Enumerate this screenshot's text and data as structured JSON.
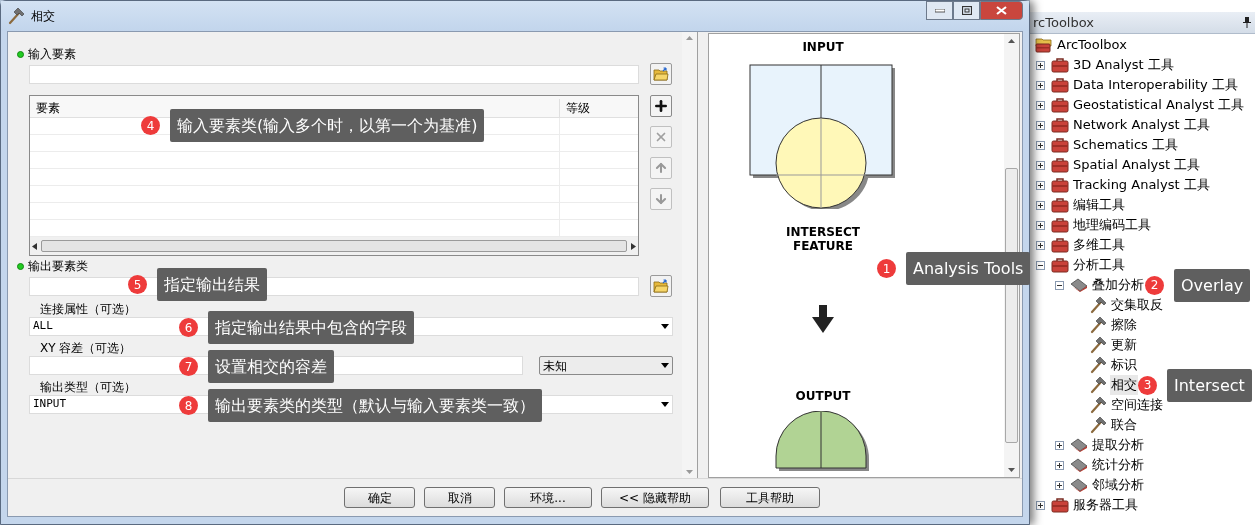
{
  "dialog": {
    "title": "相交",
    "params": [
      {
        "kind": "path",
        "label": "输入要素",
        "required": true
      },
      {
        "kind": "list",
        "columns": [
          "要素",
          "等级"
        ],
        "callout": {
          "number": "4",
          "text": "输入要素类(输入多个时，以第一个为基准)"
        }
      },
      {
        "kind": "path",
        "label": "输出要素类",
        "required": true,
        "callout": {
          "number": "5",
          "text": "指定输出结果"
        }
      },
      {
        "kind": "combo",
        "label": "连接属性（可选）",
        "value": "ALL",
        "callout": {
          "number": "6",
          "text": "指定输出结果中包含的字段"
        }
      },
      {
        "kind": "xy",
        "label": "XY 容差（可选）",
        "unit": "未知",
        "callout": {
          "number": "7",
          "text": "设置相交的容差"
        }
      },
      {
        "kind": "combo",
        "label": "输出类型（可选）",
        "value": "INPUT",
        "callout": {
          "number": "8",
          "text": "输出要素类的类型（默认与输入要素类一致）"
        }
      }
    ],
    "buttons": [
      "确定",
      "取消",
      "环境...",
      "<< 隐藏帮助"
    ],
    "help": {
      "input_label": "INPUT",
      "intersect_label": "INTERSECT FEATURE",
      "output_label": "OUTPUT",
      "button": "工具帮助",
      "callout": {
        "number": "1",
        "text": "Analysis Tools"
      }
    }
  },
  "toolbox": {
    "title": "rcToolbox",
    "tree": [
      {
        "label": "ArcToolbox",
        "kind": "root",
        "children": [
          {
            "label": "3D Analyst 工具",
            "kind": "toolbox",
            "expanded": false
          },
          {
            "label": "Data Interoperability 工具",
            "kind": "toolbox",
            "expanded": false
          },
          {
            "label": "Geostatistical Analyst 工具",
            "kind": "toolbox",
            "expanded": false
          },
          {
            "label": "Network Analyst 工具",
            "kind": "toolbox",
            "expanded": false
          },
          {
            "label": "Schematics 工具",
            "kind": "toolbox",
            "expanded": false
          },
          {
            "label": "Spatial Analyst 工具",
            "kind": "toolbox",
            "expanded": false
          },
          {
            "label": "Tracking Analyst 工具",
            "kind": "toolbox",
            "expanded": false
          },
          {
            "label": "编辑工具",
            "kind": "toolbox",
            "expanded": false
          },
          {
            "label": "地理编码工具",
            "kind": "toolbox",
            "expanded": false
          },
          {
            "label": "多维工具",
            "kind": "toolbox",
            "expanded": false
          },
          {
            "label": "分析工具",
            "kind": "toolbox",
            "expanded": true,
            "children": [
              {
                "label": "叠加分析",
                "kind": "toolset",
                "expanded": true,
                "callout": {
                  "number": "2",
                  "text": "Overlay"
                },
                "children": [
                  {
                    "label": "交集取反",
                    "kind": "tool",
                    "selected": false
                  },
                  {
                    "label": "擦除",
                    "kind": "tool",
                    "selected": false
                  },
                  {
                    "label": "更新",
                    "kind": "tool",
                    "selected": false
                  },
                  {
                    "label": "标识",
                    "kind": "tool",
                    "selected": false
                  },
                  {
                    "label": "相交",
                    "kind": "tool",
                    "selected": true,
                    "callout": {
                      "number": "3",
                      "text": "Intersect"
                    }
                  },
                  {
                    "label": "空间连接",
                    "kind": "tool",
                    "selected": false
                  },
                  {
                    "label": "联合",
                    "kind": "tool",
                    "selected": false
                  }
                ]
              },
              {
                "label": "提取分析",
                "kind": "toolset",
                "expanded": false
              },
              {
                "label": "统计分析",
                "kind": "toolset",
                "expanded": false
              },
              {
                "label": "邻域分析",
                "kind": "toolset",
                "expanded": false
              }
            ]
          },
          {
            "label": "服务器工具",
            "kind": "toolbox",
            "expanded": false
          }
        ]
      }
    ]
  }
}
